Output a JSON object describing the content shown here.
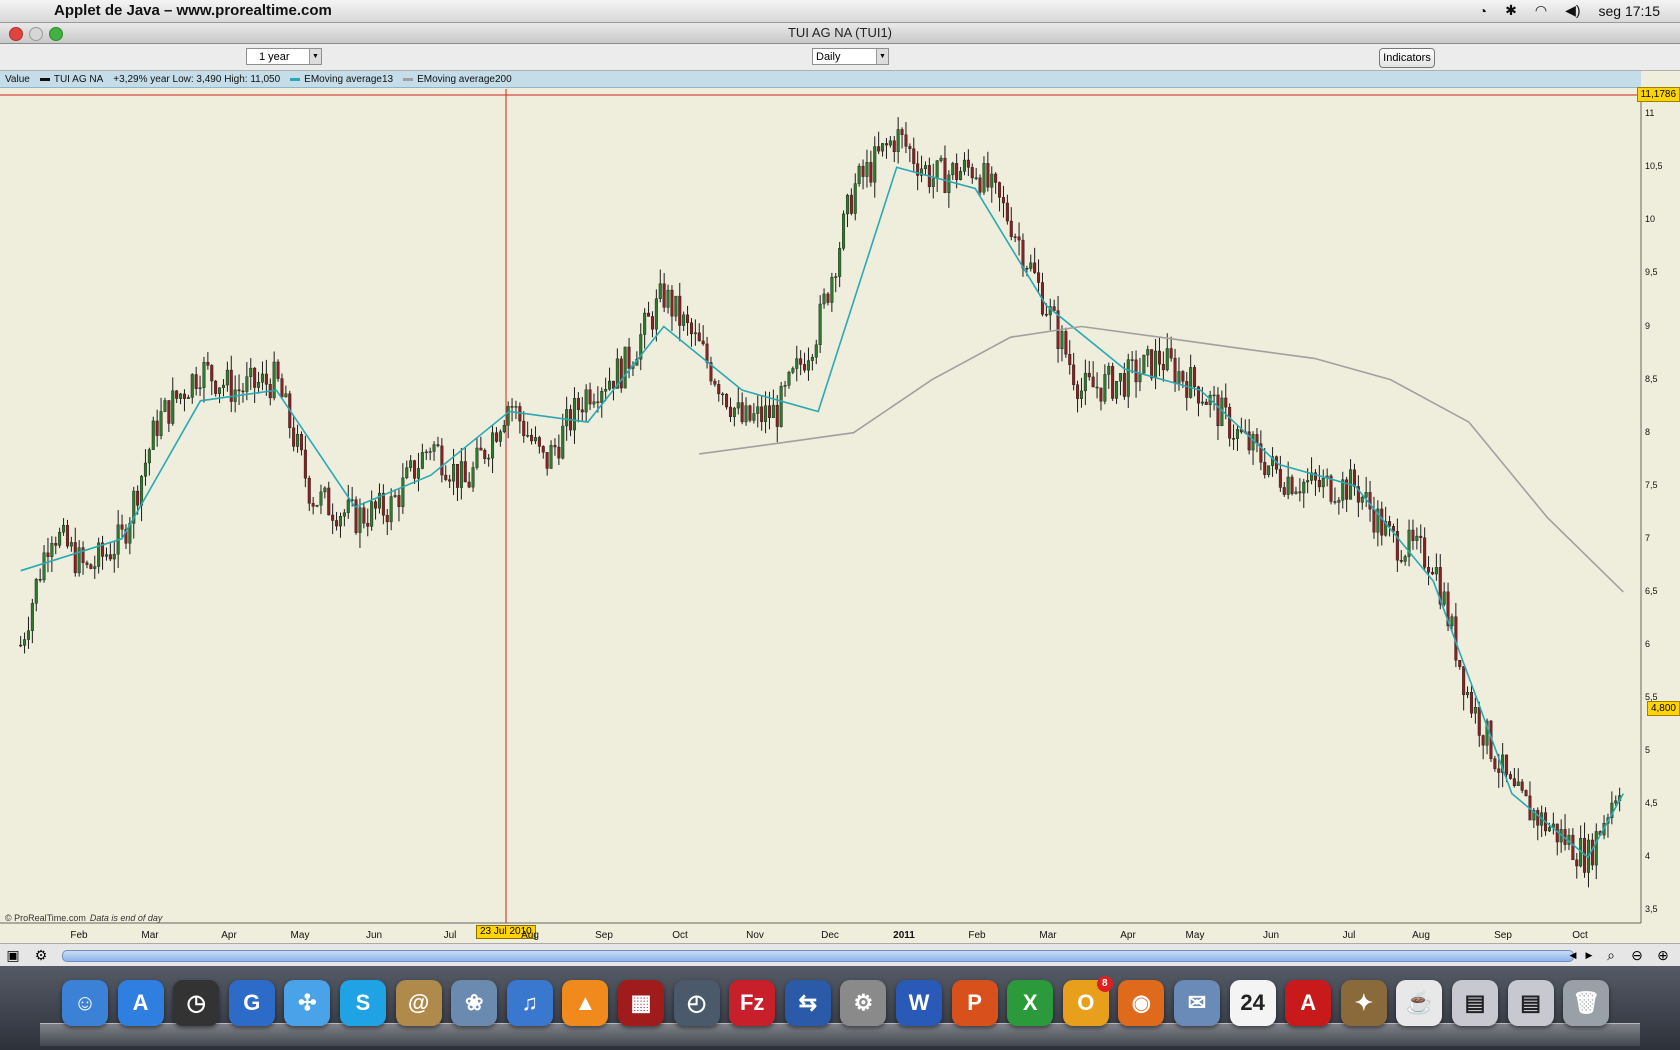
{
  "menubar": {
    "app_title": "Applet de Java – www.prorealtime.com",
    "clock": "seg 17:15"
  },
  "window": {
    "title": "TUI AG NA (TUI1)"
  },
  "toolbar": {
    "period_value": "1 year",
    "interval_value": "Daily",
    "indicators_label": "Indicators"
  },
  "legend": {
    "value_label": "Value",
    "series_name": "TUI AG NA",
    "stats": "+3,29%  year Low: 3,490  High: 11,050",
    "ema13_label": "EMoving average13",
    "ema200_label": "EMoving average200",
    "colors": {
      "price": "#1a1a1a",
      "ema13": "#2aa9b4",
      "ema200": "#a0a0a0"
    }
  },
  "chart": {
    "high_tag": "11,1786",
    "last_tag": "4,800",
    "cursor_date": "23 Jul 2010",
    "copyright": "© ProRealTime.com",
    "eod_note": "Data is end of day"
  },
  "chart_data": {
    "type": "candlestick",
    "title": "TUI AG NA (TUI1)",
    "x_ticks": [
      "Feb",
      "Mar",
      "Apr",
      "May",
      "Jun",
      "Jul",
      "Aug",
      "Sep",
      "Oct",
      "Nov",
      "Dec",
      "2011",
      "Feb",
      "Mar",
      "Apr",
      "May",
      "Jun",
      "Jul",
      "Aug",
      "Sep",
      "Oct"
    ],
    "y_ticks": [
      "3,5",
      "4",
      "4,5",
      "5",
      "5,5",
      "6",
      "6,5",
      "7",
      "7,5",
      "8",
      "8,5",
      "9",
      "9,5",
      "10",
      "10,5",
      "11"
    ],
    "ylim": [
      3.4,
      11.2
    ],
    "series": [
      {
        "name": "TUI AG NA",
        "x": [
          "2010-01-20",
          "2010-02-01",
          "2010-02-15",
          "2010-03-01",
          "2010-03-15",
          "2010-04-01",
          "2010-04-15",
          "2010-05-01",
          "2010-05-15",
          "2010-06-01",
          "2010-06-15",
          "2010-07-01",
          "2010-07-15",
          "2010-08-01",
          "2010-08-15",
          "2010-09-01",
          "2010-09-15",
          "2010-10-01",
          "2010-10-15",
          "2010-11-01",
          "2010-11-15",
          "2010-12-01",
          "2010-12-15",
          "2011-01-01",
          "2011-01-15",
          "2011-02-01",
          "2011-02-15",
          "2011-03-01",
          "2011-03-15",
          "2011-04-01",
          "2011-04-15",
          "2011-05-01",
          "2011-05-15",
          "2011-06-01",
          "2011-06-15",
          "2011-07-01",
          "2011-07-15",
          "2011-08-01",
          "2011-08-15",
          "2011-09-01",
          "2011-09-15",
          "2011-10-01",
          "2011-10-15"
        ],
        "y": [
          6.0,
          7.1,
          6.7,
          7.0,
          8.1,
          8.6,
          8.4,
          8.5,
          7.4,
          7.2,
          7.3,
          7.9,
          7.5,
          8.3,
          7.7,
          8.4,
          8.6,
          9.3,
          8.8,
          8.1,
          8.2,
          9.0,
          10.3,
          10.8,
          10.4,
          10.5,
          10.0,
          9.2,
          8.4,
          8.5,
          8.7,
          8.4,
          8.0,
          7.6,
          7.5,
          7.5,
          7.0,
          6.8,
          5.5,
          4.6,
          4.3,
          4.0,
          4.8
        ]
      },
      {
        "name": "EMoving average13",
        "x": [
          "2010-01-20",
          "2010-03-01",
          "2010-04-01",
          "2010-05-01",
          "2010-06-01",
          "2010-07-01",
          "2010-08-01",
          "2010-09-01",
          "2010-10-01",
          "2010-11-01",
          "2010-12-01",
          "2011-01-01",
          "2011-02-01",
          "2011-03-01",
          "2011-04-01",
          "2011-05-01",
          "2011-06-01",
          "2011-07-01",
          "2011-08-01",
          "2011-09-01",
          "2011-10-01",
          "2011-10-15"
        ],
        "y": [
          6.7,
          7.0,
          8.3,
          8.4,
          7.3,
          7.6,
          8.2,
          8.1,
          9.0,
          8.4,
          8.2,
          10.5,
          10.3,
          9.2,
          8.6,
          8.4,
          7.7,
          7.5,
          6.6,
          4.6,
          4.0,
          4.6
        ]
      },
      {
        "name": "EMoving average200",
        "x": [
          "2010-10-15",
          "2010-11-15",
          "2010-12-15",
          "2011-01-15",
          "2011-02-15",
          "2011-03-15",
          "2011-04-15",
          "2011-05-15",
          "2011-06-15",
          "2011-07-15",
          "2011-08-15",
          "2011-09-15",
          "2011-10-15"
        ],
        "y": [
          7.8,
          7.9,
          8.0,
          8.5,
          8.9,
          9.0,
          8.9,
          8.8,
          8.7,
          8.5,
          8.1,
          7.2,
          6.5
        ]
      }
    ]
  },
  "dock": {
    "items": [
      {
        "name": "finder-icon",
        "glyph": "☺",
        "color": "#3b82d6"
      },
      {
        "name": "app-store-icon",
        "glyph": "A",
        "color": "#2f7fe0"
      },
      {
        "name": "dashboard-icon",
        "glyph": "◷",
        "color": "#333"
      },
      {
        "name": "google-earth-icon",
        "glyph": "G",
        "color": "#2d6bc8"
      },
      {
        "name": "safari-icon",
        "glyph": "✣",
        "color": "#4aa3e8"
      },
      {
        "name": "skype-icon",
        "glyph": "S",
        "color": "#1fa3e5"
      },
      {
        "name": "address-book-icon",
        "glyph": "@",
        "color": "#b08a4a"
      },
      {
        "name": "iphoto-icon",
        "glyph": "❀",
        "color": "#6a8ab0"
      },
      {
        "name": "itunes-icon",
        "glyph": "♫",
        "color": "#3a78d0"
      },
      {
        "name": "vlc-icon",
        "glyph": "▲",
        "color": "#f08a1c"
      },
      {
        "name": "photo-booth-icon",
        "glyph": "▦",
        "color": "#a01c1c"
      },
      {
        "name": "time-machine-icon",
        "glyph": "◴",
        "color": "#4a5a6a"
      },
      {
        "name": "filezilla-icon",
        "glyph": "Fz",
        "color": "#c8202a"
      },
      {
        "name": "teamviewer-icon",
        "glyph": "⇆",
        "color": "#2a5aa8"
      },
      {
        "name": "system-preferences-icon",
        "glyph": "⚙",
        "color": "#8a8a8a"
      },
      {
        "name": "word-icon",
        "glyph": "W",
        "color": "#2a5ab8"
      },
      {
        "name": "powerpoint-icon",
        "glyph": "P",
        "color": "#d8501c"
      },
      {
        "name": "excel-icon",
        "glyph": "X",
        "color": "#2a9a3a"
      },
      {
        "name": "outlook-icon",
        "glyph": "O",
        "color": "#e8a01c",
        "badge": "8"
      },
      {
        "name": "firefox-icon",
        "glyph": "◉",
        "color": "#e06a1c"
      },
      {
        "name": "mail-icon",
        "glyph": "✉",
        "color": "#6a8ab8"
      },
      {
        "name": "ical-icon",
        "glyph": "24",
        "color": "#f4f4f4"
      },
      {
        "name": "acrobat-icon",
        "glyph": "A",
        "color": "#c81a1a"
      },
      {
        "name": "adium-icon",
        "glyph": "✦",
        "color": "#8a6a3a"
      },
      {
        "name": "java-icon",
        "glyph": "☕",
        "color": "#e8e8e8"
      },
      {
        "name": "stack-folder-icon",
        "glyph": "▤",
        "color": "#c8c8d0"
      },
      {
        "name": "stack-downloads-icon",
        "glyph": "▤",
        "color": "#c8c8d0"
      },
      {
        "name": "trash-icon",
        "glyph": "🗑",
        "color": "#9aa0a8"
      }
    ]
  }
}
